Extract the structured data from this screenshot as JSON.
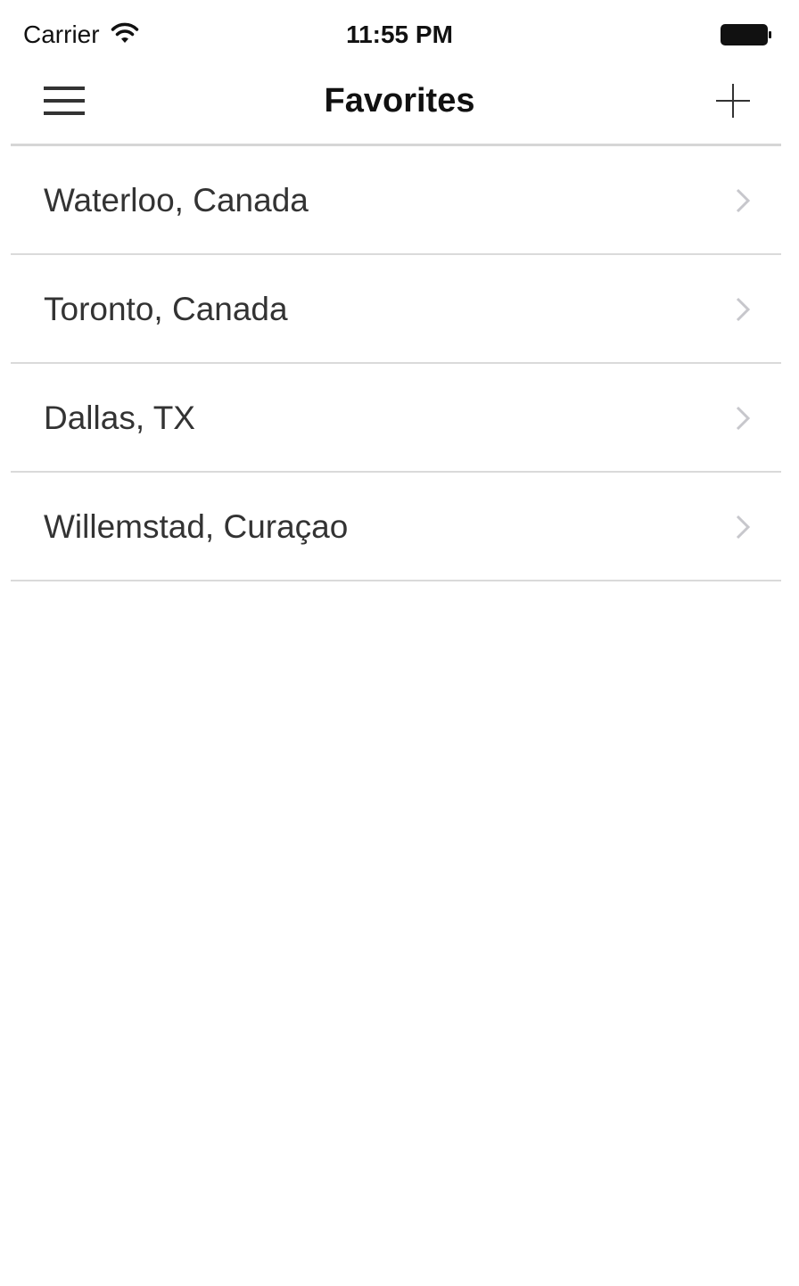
{
  "status_bar": {
    "carrier": "Carrier",
    "time": "11:55 PM",
    "wifi_icon": "wifi-icon",
    "battery_icon": "battery-full-icon"
  },
  "nav": {
    "title": "Favorites",
    "menu_icon": "hamburger-menu-icon",
    "add_icon": "plus-icon"
  },
  "favorites": [
    {
      "label": "Waterloo, Canada"
    },
    {
      "label": "Toronto, Canada"
    },
    {
      "label": "Dallas, TX"
    },
    {
      "label": "Willemstad, Curaçao"
    }
  ],
  "colors": {
    "background": "#ffffff",
    "text": "#333333",
    "divider": "#dadada",
    "chevron": "#c7c7cc"
  }
}
